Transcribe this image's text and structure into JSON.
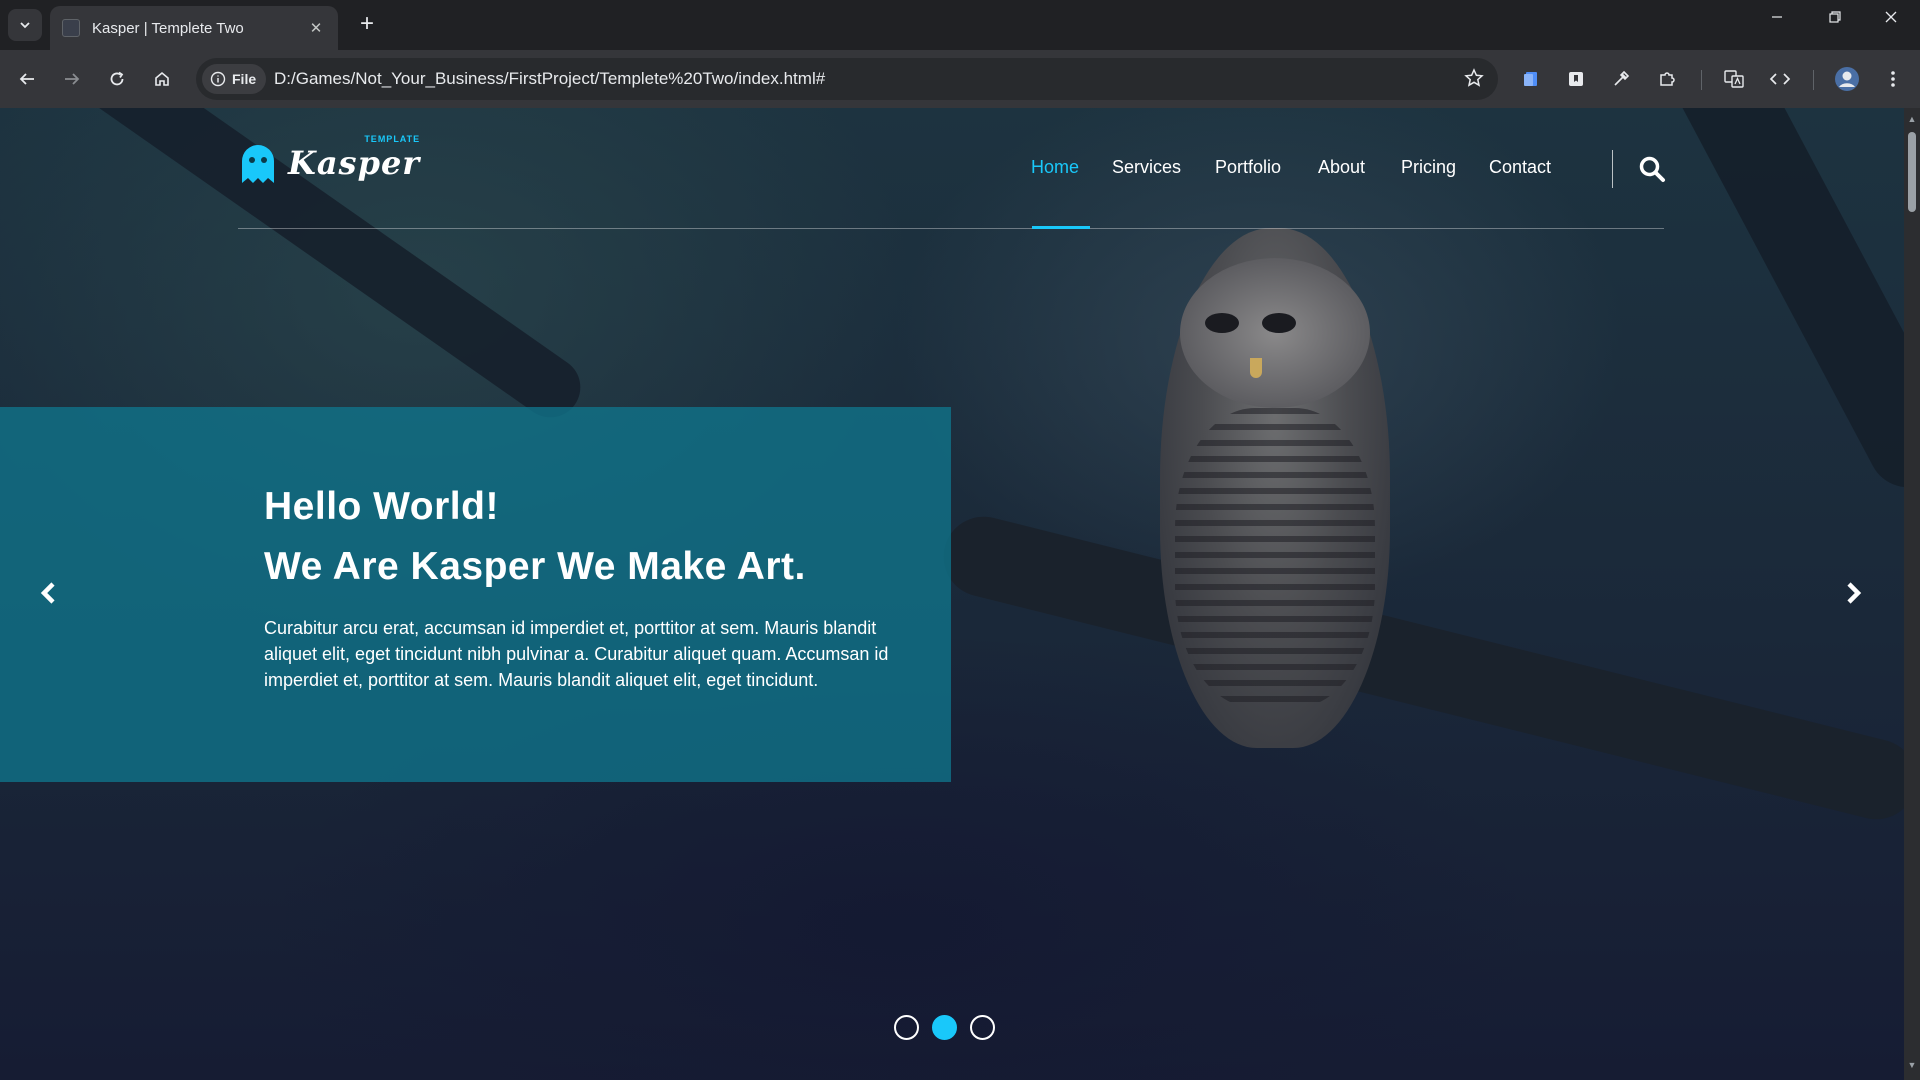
{
  "browser": {
    "tab_title": "Kasper | Templete Two",
    "new_tab": "+",
    "close_tab": "✕",
    "site_chip": "File",
    "url": "D:/Games/Not_Your_Business/FirstProject/Templete%20Two/index.html#"
  },
  "logo": {
    "word": "Kasper",
    "tag": "TEMPLATE"
  },
  "nav": {
    "items": [
      {
        "label": "Home",
        "active": true
      },
      {
        "label": "Services"
      },
      {
        "label": "Portfolio"
      },
      {
        "label": "About"
      },
      {
        "label": "Pricing"
      },
      {
        "label": "Contact"
      }
    ]
  },
  "slide": {
    "heading_line1": "Hello World!",
    "heading_line2": "We Are Kasper We Make Art.",
    "text": "Curabitur arcu erat, accumsan id imperdiet et, porttitor at sem. Mauris blandit aliquet elit, eget tincidunt nibh pulvinar a. Curabitur aliquet quam. Accumsan id imperdiet et, porttitor at sem. Mauris blandit aliquet elit, eget tincidunt."
  },
  "bullets": {
    "count": 3,
    "active_index": 1
  },
  "colors": {
    "accent": "#19c8fa",
    "slide_box": "#0f748c",
    "chrome_bg": "#202124",
    "toolbar_bg": "#35363a"
  }
}
